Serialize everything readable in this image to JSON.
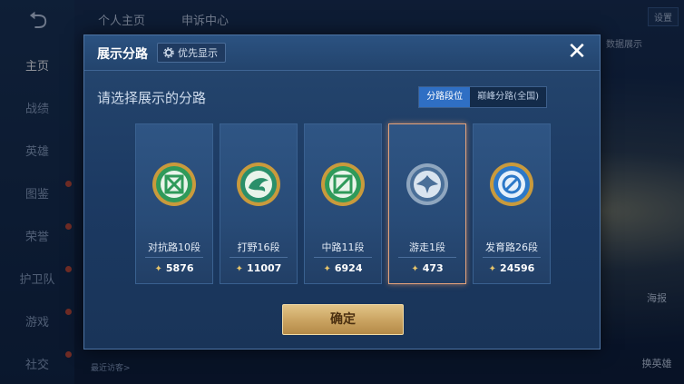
{
  "background": {
    "top_tabs": [
      "个人主页",
      "申诉中心"
    ],
    "nav_items": [
      {
        "label": "主页",
        "active": true
      },
      {
        "label": "战绩"
      },
      {
        "label": "英雄"
      },
      {
        "label": "图鉴"
      },
      {
        "label": "荣誉"
      },
      {
        "label": "护卫队"
      },
      {
        "label": "游戏"
      },
      {
        "label": "社交"
      }
    ],
    "top_right": [
      "设置"
    ],
    "side_buttons": [
      "海报",
      "换英雄"
    ],
    "bottom_text": "最近访客>",
    "partial_right_text": "数据展示"
  },
  "modal": {
    "title": "展示分路",
    "priority_label": "优先显示",
    "close_symbol": "✕",
    "prompt": "请选择展示的分路",
    "segments": [
      "分路段位",
      "巅峰分路(全国)"
    ],
    "active_segment": 0,
    "cards": [
      {
        "name": "对抗路10段",
        "score": "5876",
        "emblem": "clash-lane-icon",
        "color": "#2f9a5a"
      },
      {
        "name": "打野16段",
        "score": "11007",
        "emblem": "jungle-dragon-icon",
        "color": "#2a8f6a"
      },
      {
        "name": "中路11段",
        "score": "6924",
        "emblem": "mid-lane-icon",
        "color": "#2f9a5a"
      },
      {
        "name": "游走1段",
        "score": "473",
        "emblem": "roam-wing-icon",
        "color": "#4a6f98",
        "selected": true
      },
      {
        "name": "发育路26段",
        "score": "24596",
        "emblem": "farm-lane-icon",
        "color": "#2c78c8"
      }
    ],
    "confirm_label": "确定"
  },
  "colors": {
    "accent": "#2f6fc4",
    "selected_border": "#e4a37c",
    "gold": "#e8c56a",
    "confirm": "#c9a260"
  }
}
